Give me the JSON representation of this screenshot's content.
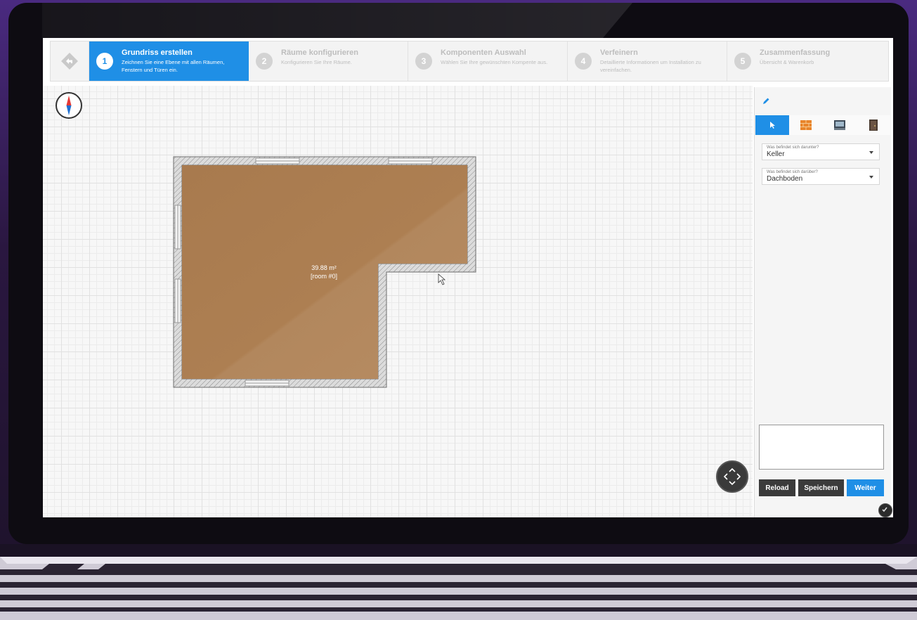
{
  "steps": [
    {
      "num": "1",
      "title": "Grundriss erstellen",
      "desc": "Zeichnen Sie eine Ebene mit allen Räumen, Fenstern und Türen ein."
    },
    {
      "num": "2",
      "title": "Räume konfigurieren",
      "desc": "Konfigurieren Sie Ihre Räume."
    },
    {
      "num": "3",
      "title": "Komponenten Auswahl",
      "desc": "Wählen Sie Ihre gewünschten Kompente aus."
    },
    {
      "num": "4",
      "title": "Verfeinern",
      "desc": "Detaillierte Informationen um Installation zu vereinfachen."
    },
    {
      "num": "5",
      "title": "Zusammenfassung",
      "desc": "Übersicht & Warenkorb"
    }
  ],
  "room": {
    "area": "39.88 m²",
    "name": "[room #0]"
  },
  "panel": {
    "below_label": "Was befindet sich darunter?",
    "below_value": "Keller",
    "above_label": "Was befindet sich darüber?",
    "above_value": "Dachboden"
  },
  "buttons": {
    "reload": "Reload",
    "save": "Speichern",
    "next": "Weiter"
  },
  "colors": {
    "accent": "#1f8fe6",
    "floor": "#a87a4e"
  }
}
